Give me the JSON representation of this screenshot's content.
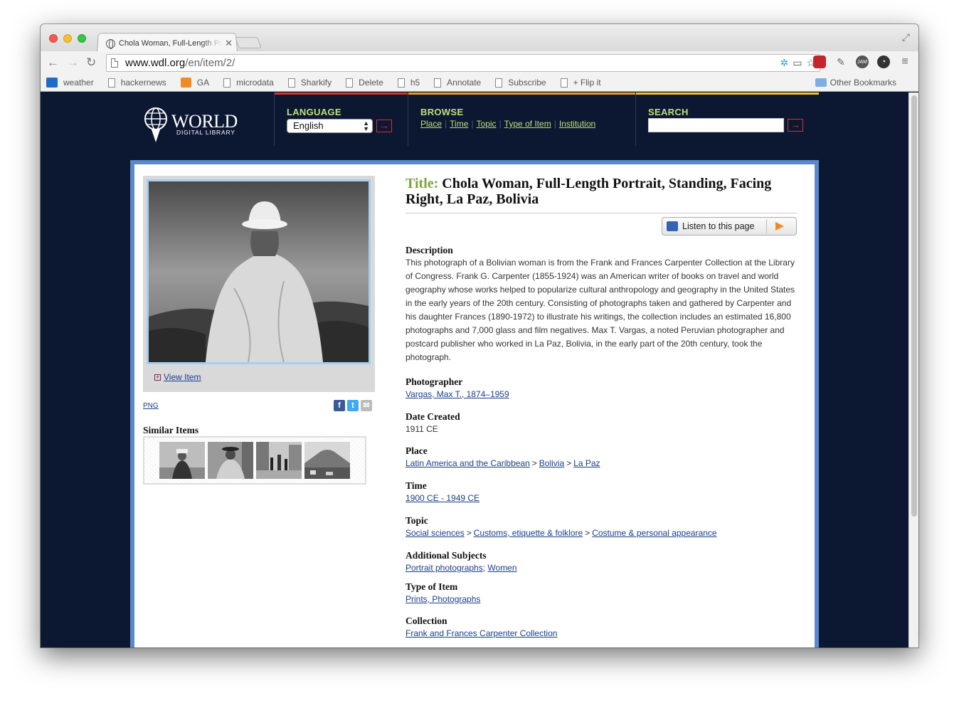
{
  "browser": {
    "tab_title": "Chola Woman, Full-Length Portrait",
    "url_host": "www.wdl.org",
    "url_path": "/en/item/2/",
    "bookmarks": [
      "weather",
      "hackernews",
      "GA",
      "microdata",
      "Sharkify",
      "Delete",
      "h5",
      "Annotate",
      "Subscribe",
      "+ Flip it"
    ],
    "other_bookmarks": "Other Bookmarks"
  },
  "header": {
    "logo_word": "WORLD",
    "logo_sub": "DIGITAL LIBRARY",
    "language_label": "LANGUAGE",
    "language_value": "English",
    "browse_label": "BROWSE",
    "browse_links": [
      "Place",
      "Time",
      "Topic",
      "Type of Item",
      "Institution"
    ],
    "search_label": "SEARCH",
    "go_arrow": "→"
  },
  "item": {
    "title_label": "Title:",
    "title": "Chola Woman, Full-Length Portrait, Standing, Facing Right, La Paz, Bolivia",
    "listen_label": "Listen to this page",
    "view_item": "View Item",
    "png": "PNG",
    "similar_items": "Similar Items",
    "description_label": "Description",
    "description": "This photograph of a Bolivian woman is from the Frank and Frances Carpenter Collection at the Library of Congress. Frank G. Carpenter (1855-1924) was an American writer of books on travel and world geography whose works helped to popularize cultural anthropology and geography in the United States in the early years of the 20th century. Consisting of photographs taken and gathered by Carpenter and his daughter Frances (1890-1972) to illustrate his writings, the collection includes an estimated 16,800 photographs and 7,000 glass and film negatives. Max T. Vargas, a noted Peruvian photographer and postcard publisher who worked in La Paz, Bolivia, in the early part of the 20th century, took the photograph.",
    "photographer_label": "Photographer",
    "photographer": "Vargas, Max T., 1874–1959",
    "date_label": "Date Created",
    "date": "1911 CE",
    "place_label": "Place",
    "place": [
      "Latin America and the Caribbean",
      "Bolivia",
      "La Paz"
    ],
    "time_label": "Time",
    "time": "1900 CE - 1949 CE",
    "topic_label": "Topic",
    "topic": [
      "Social sciences",
      "Customs, etiquette & folklore",
      "Costume & personal appearance"
    ],
    "subjects_label": "Additional Subjects",
    "subjects": [
      "Portrait photographs",
      "Women"
    ],
    "type_label": "Type of Item",
    "type": "Prints, Photographs",
    "collection_label": "Collection",
    "collection": "Frank and Frances Carpenter Collection"
  }
}
